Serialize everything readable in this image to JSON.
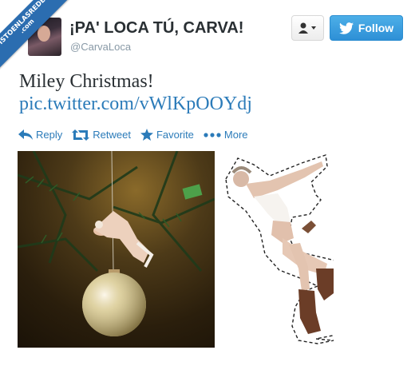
{
  "watermark": {
    "line1": "VISTOENLASREDES",
    "line2": ".com"
  },
  "user": {
    "display_name": "¡PA' LOCA TÚ, CARVA!",
    "screen_name": "@CarvaLoca"
  },
  "buttons": {
    "follow_label": "Follow",
    "user_menu_icon": "user-dropdown-icon"
  },
  "tweet": {
    "text": "Miley Christmas!",
    "link": "pic.twitter.com/vWlKpOOYdj"
  },
  "actions": [
    {
      "label": "Reply",
      "icon": "reply-icon"
    },
    {
      "label": "Retweet",
      "icon": "retweet-icon"
    },
    {
      "label": "Favorite",
      "icon": "star-icon"
    },
    {
      "label": "More",
      "icon": "more-dots-icon"
    }
  ],
  "colors": {
    "link": "#2b7bb9",
    "follow_button": "#2d8fd6",
    "ribbon": "#2b6db0",
    "muted": "#8899a6"
  }
}
